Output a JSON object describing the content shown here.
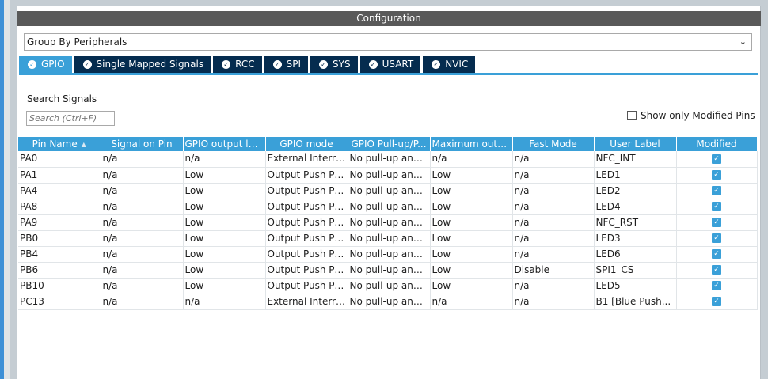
{
  "panel": {
    "title": "Configuration"
  },
  "group_select": {
    "value": "Group By Peripherals"
  },
  "tabs": [
    {
      "label": "GPIO",
      "active": true
    },
    {
      "label": "Single Mapped Signals",
      "active": false
    },
    {
      "label": "RCC",
      "active": false
    },
    {
      "label": "SPI",
      "active": false
    },
    {
      "label": "SYS",
      "active": false
    },
    {
      "label": "USART",
      "active": false
    },
    {
      "label": "NVIC",
      "active": false
    }
  ],
  "search": {
    "label": "Search Signals",
    "placeholder": "Search (Ctrl+F)"
  },
  "show_modified": {
    "label": "Show only Modified Pins",
    "checked": false
  },
  "table": {
    "columns": [
      "Pin Name",
      "Signal on Pin",
      "GPIO output level",
      "GPIO mode",
      "GPIO Pull-up/P...",
      "Maximum outp...",
      "Fast Mode",
      "User Label",
      "Modified"
    ],
    "rows": [
      [
        "PA0",
        "n/a",
        "n/a",
        "External Interru...",
        "No pull-up and ...",
        "n/a",
        "n/a",
        "NFC_INT",
        true
      ],
      [
        "PA1",
        "n/a",
        "Low",
        "Output Push Pull",
        "No pull-up and ...",
        "Low",
        "n/a",
        "LED1",
        true
      ],
      [
        "PA4",
        "n/a",
        "Low",
        "Output Push Pull",
        "No pull-up and ...",
        "Low",
        "n/a",
        "LED2",
        true
      ],
      [
        "PA8",
        "n/a",
        "Low",
        "Output Push Pull",
        "No pull-up and ...",
        "Low",
        "n/a",
        "LED4",
        true
      ],
      [
        "PA9",
        "n/a",
        "Low",
        "Output Push Pull",
        "No pull-up and ...",
        "Low",
        "n/a",
        "NFC_RST",
        true
      ],
      [
        "PB0",
        "n/a",
        "Low",
        "Output Push Pull",
        "No pull-up and ...",
        "Low",
        "n/a",
        "LED3",
        true
      ],
      [
        "PB4",
        "n/a",
        "Low",
        "Output Push Pull",
        "No pull-up and ...",
        "Low",
        "n/a",
        "LED6",
        true
      ],
      [
        "PB6",
        "n/a",
        "Low",
        "Output Push Pull",
        "No pull-up and ...",
        "Low",
        "Disable",
        "SPI1_CS",
        true
      ],
      [
        "PB10",
        "n/a",
        "Low",
        "Output Push Pull",
        "No pull-up and ...",
        "Low",
        "n/a",
        "LED5",
        true
      ],
      [
        "PC13",
        "n/a",
        "n/a",
        "External Interru...",
        "No pull-up and ...",
        "n/a",
        "n/a",
        "B1 [Blue Push...",
        true
      ]
    ]
  },
  "colors": {
    "accent": "#3aa0d8",
    "tab_inactive": "#052c4f",
    "title_bar": "#595959"
  }
}
